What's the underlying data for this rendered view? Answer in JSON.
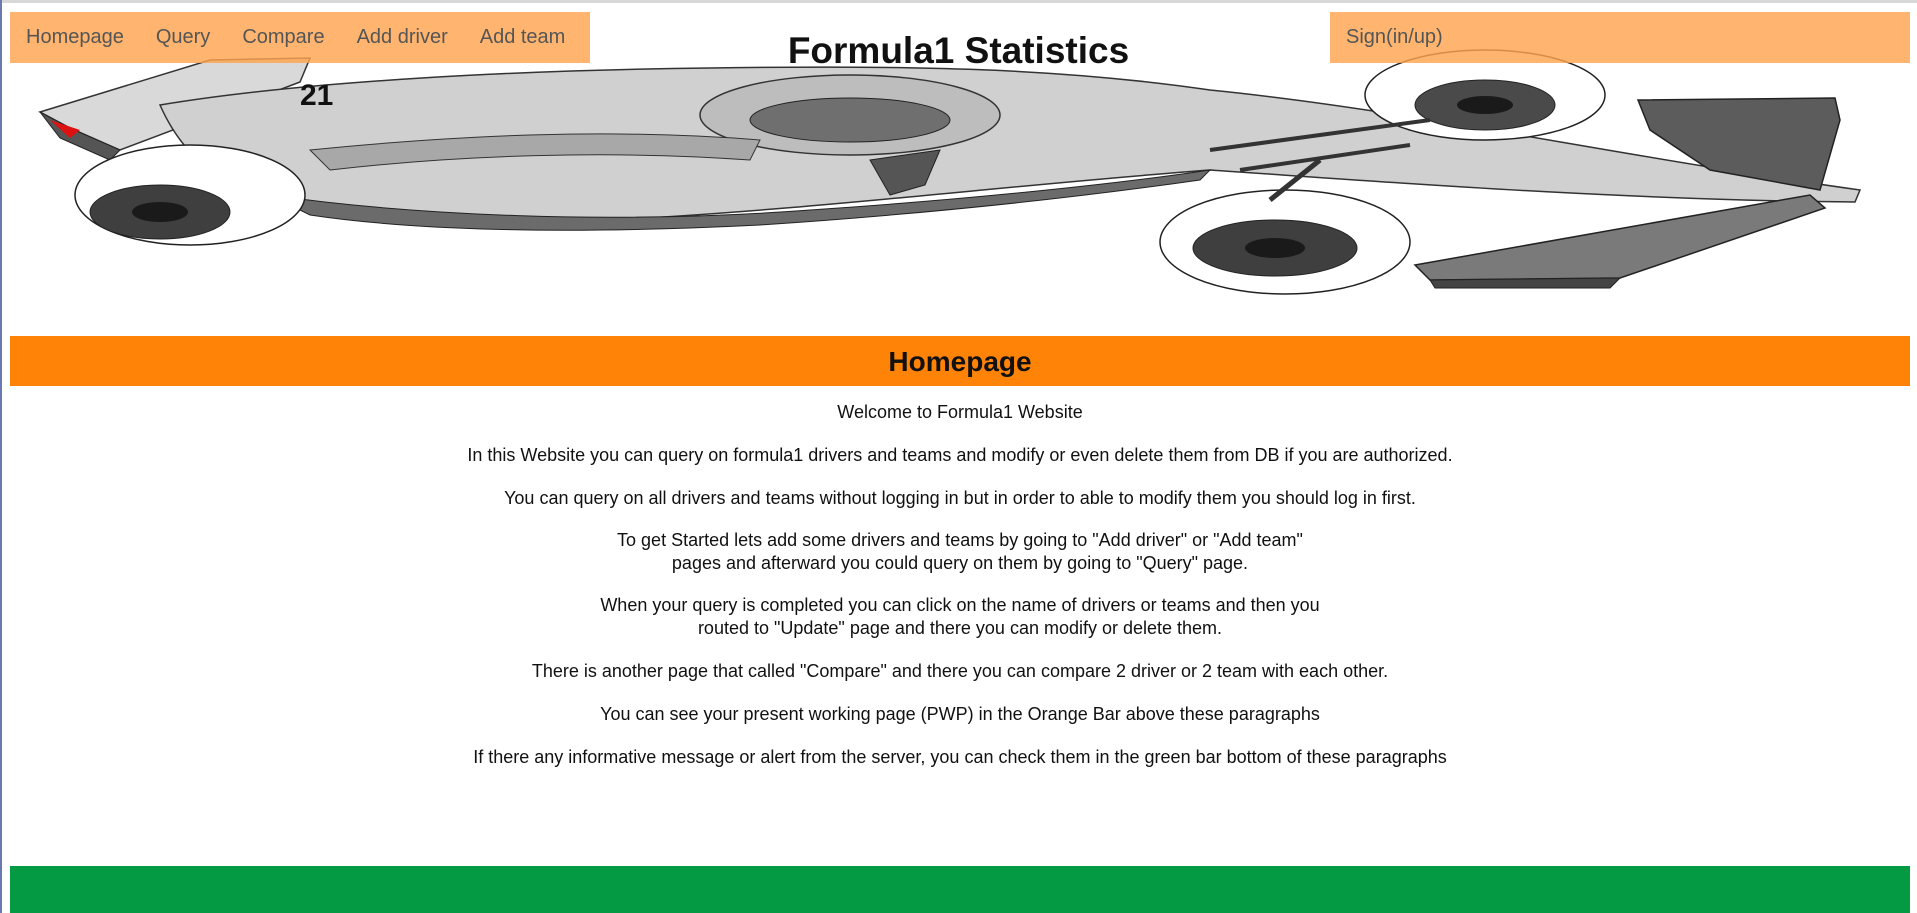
{
  "nav": {
    "items": [
      {
        "label": "Homepage"
      },
      {
        "label": "Query"
      },
      {
        "label": "Compare"
      },
      {
        "label": "Add driver"
      },
      {
        "label": "Add team"
      }
    ],
    "sign_label": "Sign(in/up)"
  },
  "header": {
    "title": "Formula1 Statistics"
  },
  "page_bar": {
    "title": "Homepage"
  },
  "content": {
    "welcome": "Welcome to Formula1 Website",
    "p1": "In this Website you can query on formula1 drivers and teams and modify or even delete them from DB if you are authorized.",
    "p2": "You can query on all drivers and teams without logging in but in order to able to modify them you should log in first.",
    "p3_line1": "To get Started lets add some drivers and teams by going to \"Add driver\" or \"Add team\"",
    "p3_line2": "pages and afterward you could query on them by going to \"Query\" page.",
    "p4_line1": "When your query is completed you can click on the name of drivers or teams and then you",
    "p4_line2": "routed to \"Update\" page and there you can modify or delete them.",
    "p5": "There is another page that called \"Compare\" and there you can compare 2 driver or 2 team with each other.",
    "p6": "You can see your present working page (PWP) in the Orange Bar above these paragraphs",
    "p7": "If there any informative message or alert from the server, you can check them in the green bar bottom of these paragraphs"
  },
  "colors": {
    "nav_bg": "#ffa54f",
    "page_bar": "#ff8306",
    "message_bar": "#039a43"
  }
}
